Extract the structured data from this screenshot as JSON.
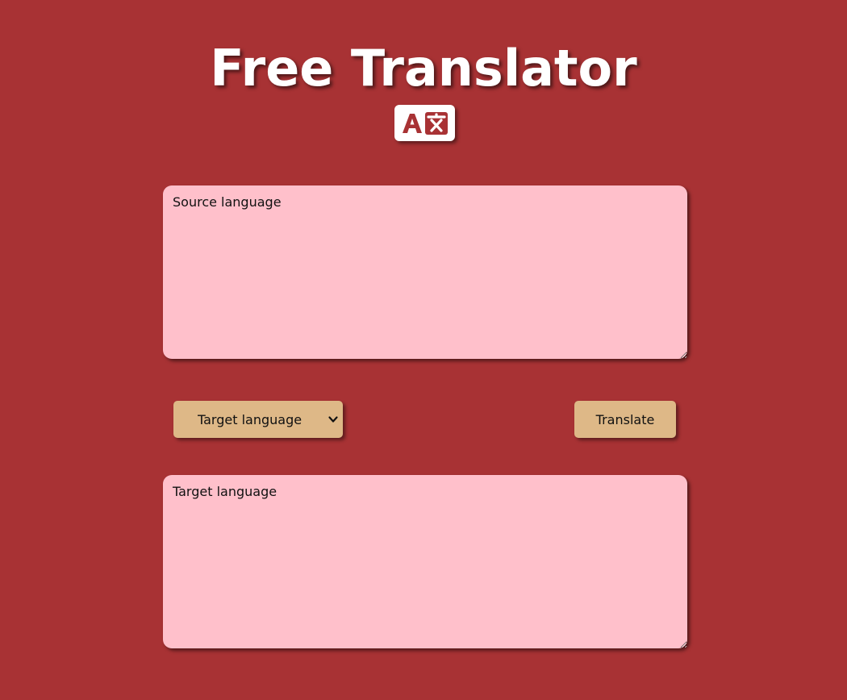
{
  "header": {
    "title": "Free Translator",
    "logo_icon": "translate-icon",
    "logo_text": "A文"
  },
  "source": {
    "placeholder": "Source language",
    "value": ""
  },
  "controls": {
    "target_select": {
      "selected": "Target language",
      "options": [
        "Target language"
      ],
      "icon": "chevron-down-icon"
    },
    "translate_label": "Translate"
  },
  "output": {
    "placeholder": "Target language",
    "value": ""
  },
  "colors": {
    "background": "#a83234",
    "textarea": "#ffc0cb",
    "button": "#deb887",
    "title": "#ffffff"
  }
}
